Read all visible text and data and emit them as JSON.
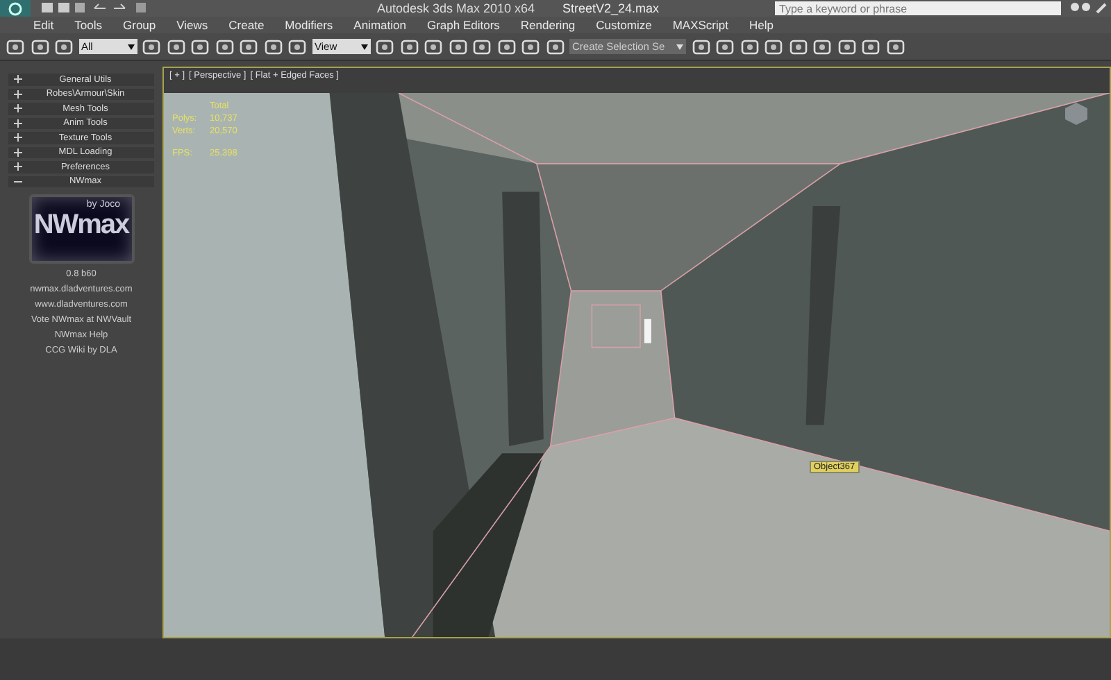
{
  "window": {
    "title": "Autodesk 3ds Max  2010 x64",
    "file": "StreetV2_24.max",
    "search": {
      "placeholder": "Type a keyword or phrase"
    }
  },
  "menu": [
    "Edit",
    "Tools",
    "Group",
    "Views",
    "Create",
    "Modifiers",
    "Animation",
    "Graph Editors",
    "Rendering",
    "Customize",
    "MAXScript",
    "Help"
  ],
  "toolbar": {
    "filter": "All",
    "coordinate_system": "View",
    "selection_set": "Create Selection Se"
  },
  "rollouts": [
    {
      "label": "General Utils",
      "expanded": false
    },
    {
      "label": "Robes\\Armour\\Skin",
      "expanded": false
    },
    {
      "label": "Mesh Tools",
      "expanded": false
    },
    {
      "label": "Anim Tools",
      "expanded": false
    },
    {
      "label": "Texture Tools",
      "expanded": false
    },
    {
      "label": "MDL Loading",
      "expanded": false
    },
    {
      "label": "Preferences",
      "expanded": false
    },
    {
      "label": "NWmax",
      "expanded": true
    }
  ],
  "nwmax": {
    "logo_byline": "by Joco",
    "logo_text": "NWmax",
    "version": "0.8 b60",
    "links": [
      "nwmax.dladventures.com",
      "www.dladventures.com",
      "Vote NWmax at NWVault",
      "NWmax Help",
      "CCG Wiki by DLA"
    ]
  },
  "viewport": {
    "labels": [
      "[ + ]",
      "[ Perspective ]",
      "[ Flat + Edged Faces ]"
    ],
    "stats_header": "Total",
    "stats": [
      {
        "name": "Polys:",
        "value": "10,737"
      },
      {
        "name": "Verts:",
        "value": "20,570"
      },
      {
        "name": "FPS:",
        "value": "25.398"
      }
    ],
    "object_label": "Object367"
  }
}
